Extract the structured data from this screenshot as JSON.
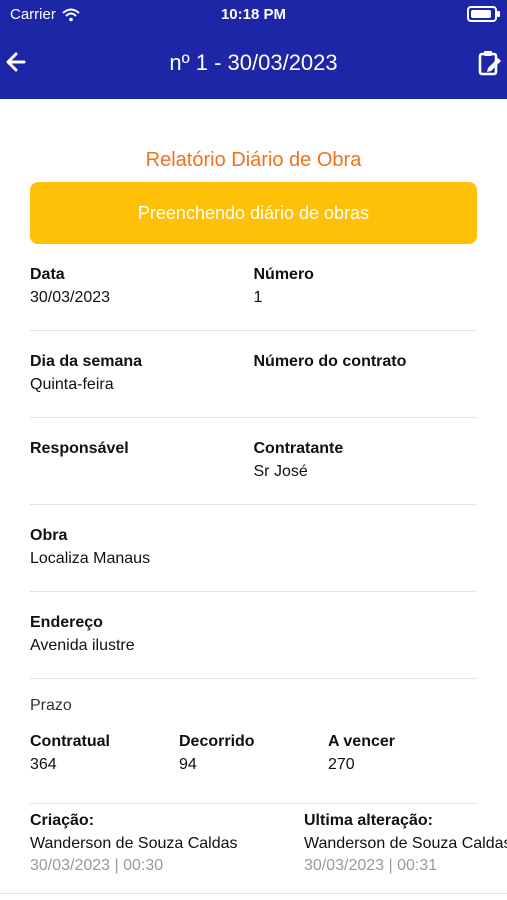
{
  "statusbar": {
    "carrier": "Carrier",
    "time": "10:18 PM"
  },
  "nav": {
    "title": "nº 1 - 30/03/2023"
  },
  "report": {
    "heading": "Relatório Diário de Obra",
    "status": "Preenchendo diário de obras",
    "fields": {
      "data": {
        "label": "Data",
        "value": "30/03/2023"
      },
      "numero": {
        "label": "Número",
        "value": "1"
      },
      "dia_semana": {
        "label": "Dia da semana",
        "value": "Quinta-feira"
      },
      "numero_contrato": {
        "label": "Número do contrato",
        "value": ""
      },
      "responsavel": {
        "label": "Responsável",
        "value": ""
      },
      "contratante": {
        "label": "Contratante",
        "value": "Sr José"
      },
      "obra": {
        "label": "Obra",
        "value": "Localiza Manaus"
      },
      "endereco": {
        "label": "Endereço",
        "value": "Avenida ilustre"
      }
    },
    "prazo": {
      "title": "Prazo",
      "contratual": {
        "label": "Contratual",
        "value": "364"
      },
      "decorrido": {
        "label": "Decorrido",
        "value": "94"
      },
      "a_vencer": {
        "label": "A vencer",
        "value": "270"
      }
    },
    "meta": {
      "criacao": {
        "label": "Criação:",
        "user": "Wanderson de Souza Caldas",
        "time": "30/03/2023 | 00:30"
      },
      "alteracao": {
        "label": "Ultima alteração:",
        "user": "Wanderson de Souza Caldas",
        "time": "30/03/2023 | 00:31"
      }
    }
  },
  "colors": {
    "nav_bg": "#1c26a6",
    "heading": "#f2711c",
    "banner": "#ffc107"
  },
  "icons": {
    "back": "arrow-left-icon",
    "report": "clipboard-edit-icon",
    "wifi": "wifi-icon",
    "battery": "battery-icon"
  }
}
